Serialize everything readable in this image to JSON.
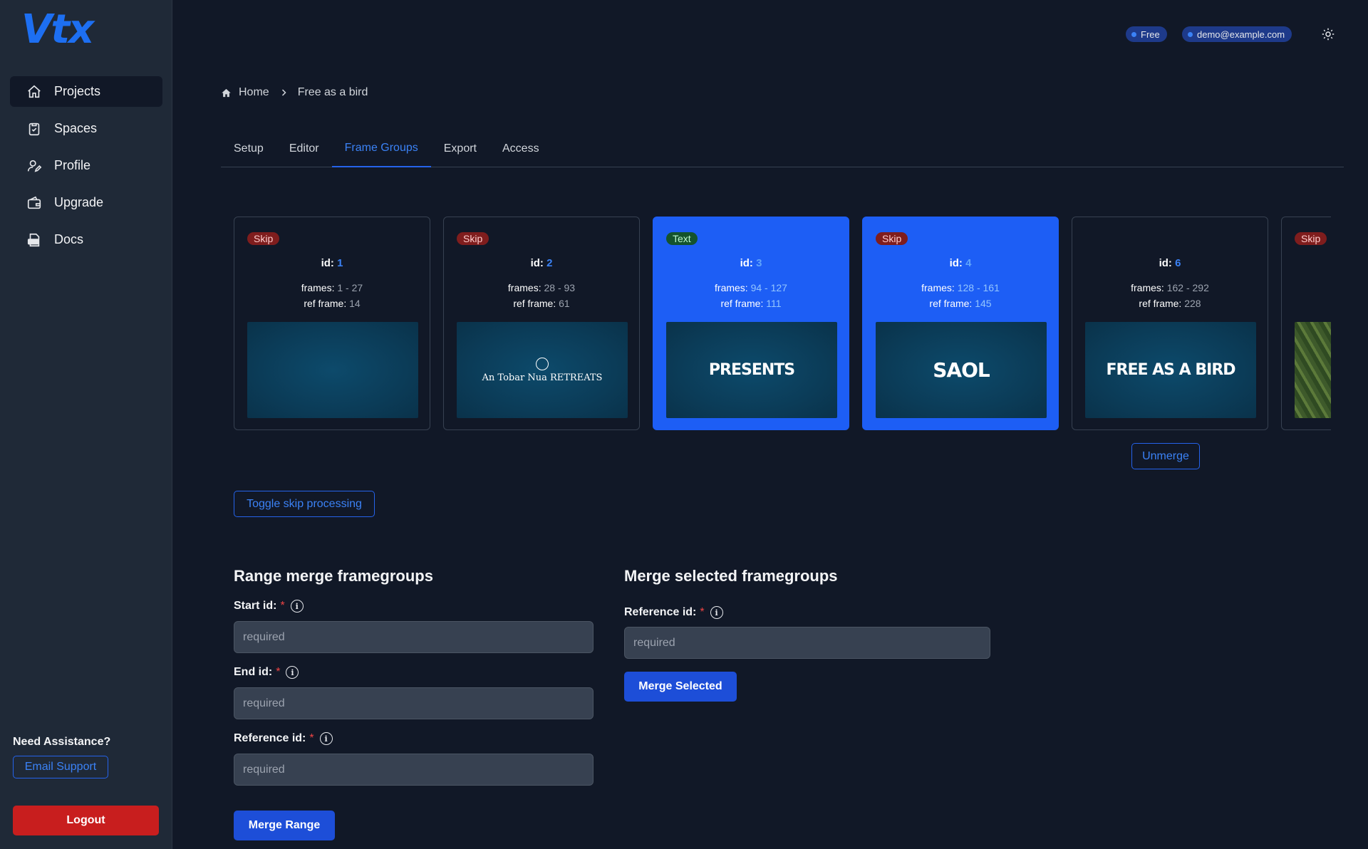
{
  "app": {
    "logo_text": "Vtx"
  },
  "sidebar": {
    "items": [
      {
        "label": "Projects",
        "icon": "home-icon",
        "active": true
      },
      {
        "label": "Spaces",
        "icon": "clipboard-icon",
        "active": false
      },
      {
        "label": "Profile",
        "icon": "user-edit-icon",
        "active": false
      },
      {
        "label": "Upgrade",
        "icon": "wallet-icon",
        "active": false
      },
      {
        "label": "Docs",
        "icon": "doc-icon",
        "active": false
      }
    ],
    "assist_heading": "Need Assistance?",
    "email_support": "Email Support",
    "logout": "Logout"
  },
  "header": {
    "plan_badge": "Free",
    "user_badge": "demo@example.com",
    "theme_icon": "sun-icon"
  },
  "breadcrumb": {
    "home": "Home",
    "current": "Free as a bird"
  },
  "tabs": [
    {
      "label": "Setup",
      "active": false
    },
    {
      "label": "Editor",
      "active": false
    },
    {
      "label": "Frame Groups",
      "active": true
    },
    {
      "label": "Export",
      "active": false
    },
    {
      "label": "Access",
      "active": false
    }
  ],
  "frame_groups": [
    {
      "tag": "Skip",
      "id": "1",
      "frames": "1 - 27",
      "ref_frame": "14",
      "selected": false,
      "thumb": ""
    },
    {
      "tag": "Skip",
      "id": "2",
      "frames": "28 - 93",
      "ref_frame": "61",
      "selected": false,
      "thumb": "An Tobar Nua RETREATS"
    },
    {
      "tag": "Text",
      "id": "3",
      "frames": "94 - 127",
      "ref_frame": "111",
      "selected": true,
      "thumb": "PRESENTS"
    },
    {
      "tag": "Skip",
      "id": "4",
      "frames": "128 - 161",
      "ref_frame": "145",
      "selected": true,
      "thumb": "SAOL"
    },
    {
      "tag": "",
      "id": "6",
      "frames": "162 - 292",
      "ref_frame": "228",
      "selected": false,
      "thumb": "FREE AS A BIRD"
    },
    {
      "tag": "Skip",
      "id": "",
      "frames": "",
      "ref_frame": "",
      "selected": false,
      "thumb": ""
    }
  ],
  "labels": {
    "id": "id:",
    "frames": "frames:",
    "ref_frame": "ref frame:",
    "unmerge": "Unmerge",
    "toggle_skip": "Toggle skip processing"
  },
  "range_merge": {
    "title": "Range merge framegroups",
    "start_label": "Start id:",
    "end_label": "End id:",
    "ref_label": "Reference id:",
    "placeholder": "required",
    "button": "Merge Range"
  },
  "selected_merge": {
    "title": "Merge selected framegroups",
    "ref_label": "Reference id:",
    "placeholder": "required",
    "button": "Merge Selected"
  },
  "required_mark": "*",
  "colors": {
    "accent": "#1d5ef5",
    "danger": "#c81e1e",
    "sidebar": "#1f2937",
    "background": "#111827"
  }
}
